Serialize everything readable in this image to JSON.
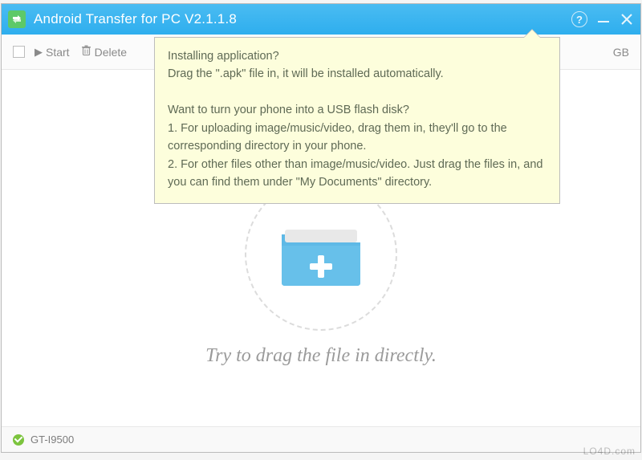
{
  "titlebar": {
    "title": "Android Transfer for PC V2.1.1.8"
  },
  "toolbar": {
    "start_label": "Start",
    "delete_label": "Delete",
    "free_space_suffix": "GB"
  },
  "tooltip": {
    "line1": "Installing application?",
    "line2": "Drag the \".apk\" file in, it will be installed automatically.",
    "line3": "Want to turn your phone into a USB flash disk?",
    "line4": "1. For uploading image/music/video, drag them in, they'll go to the corresponding directory in your phone.",
    "line5": "2. For other files other than image/music/video. Just drag the files in, and you can find them under \"My Documents\" directory."
  },
  "dropzone": {
    "text": "Try to drag the file in directly."
  },
  "statusbar": {
    "device": "GT-I9500"
  },
  "watermark": "LO4D.com"
}
